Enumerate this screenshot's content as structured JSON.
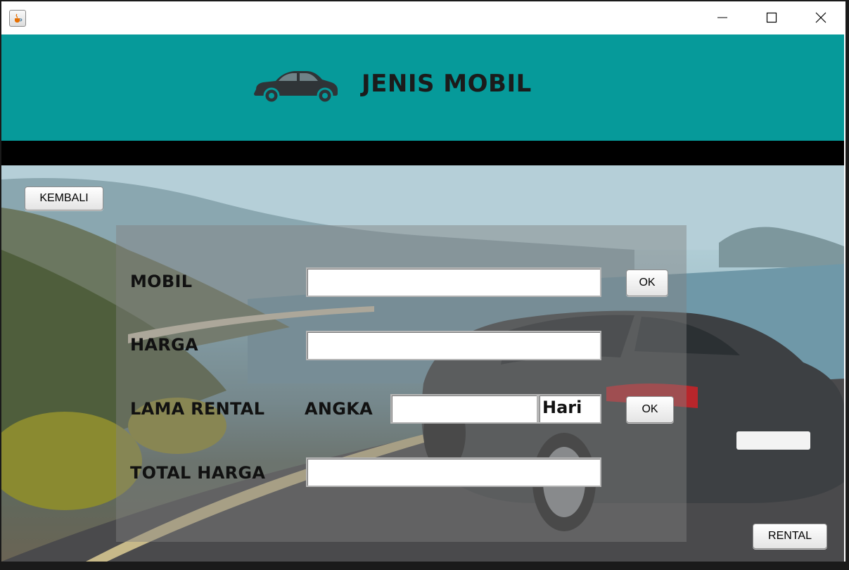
{
  "window": {
    "controls": {
      "minimize": "—",
      "maximize": "☐",
      "close": "✕"
    },
    "app_icon": "java-cup-icon"
  },
  "header": {
    "title": "JENIS MOBIL",
    "icon": "car-icon",
    "bg_color": "#069a9a"
  },
  "buttons": {
    "back": "KEMBALI",
    "ok_mobil": "OK",
    "ok_lama": "OK",
    "rental": "RENTAL"
  },
  "form": {
    "mobil_label": "MOBIL",
    "mobil_value": "",
    "harga_label": "HARGA",
    "harga_value": "",
    "lama_label": "LAMA RENTAL",
    "angka_label": "ANGKA",
    "angka_value": "",
    "hari_value": "Hari",
    "total_label": "TOTAL HARGA",
    "total_value": ""
  }
}
